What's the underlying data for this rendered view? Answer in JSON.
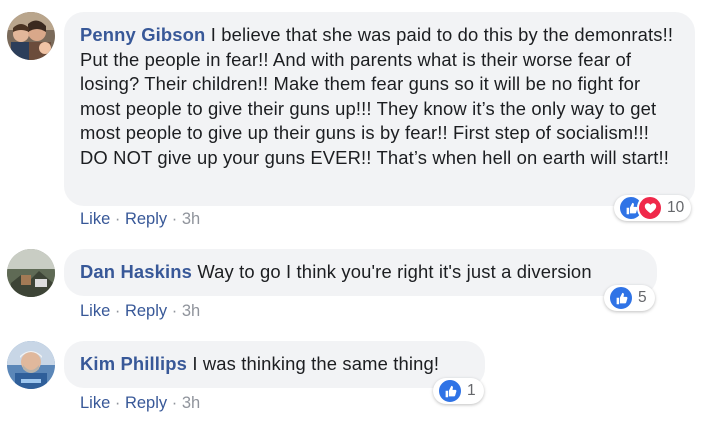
{
  "comments": [
    {
      "author": "Penny Gibson",
      "text": "I believe that she was paid to do this by the demonrats!! Put the people in fear!! And with parents what is their worse fear of losing? Their children!! Make them fear guns so it will be no fight for most people to give their guns up!!! They know it’s the only way to get most people to give up their guns is by fear!! First step of socialism!!! DO NOT give up your guns EVER!! That’s when hell on earth will start!!",
      "like_label": "Like",
      "reply_label": "Reply",
      "time": "3h",
      "reaction_count": "10",
      "reaction_types": [
        "like-icon",
        "love-icon"
      ]
    },
    {
      "author": "Dan Haskins",
      "text": "Way to go I think you're right it's just a diversion",
      "like_label": "Like",
      "reply_label": "Reply",
      "time": "3h",
      "reaction_count": "5",
      "reaction_types": [
        "like-icon"
      ]
    },
    {
      "author": "Kim Phillips",
      "text": "I was thinking the same thing!",
      "like_label": "Like",
      "reply_label": "Reply",
      "time": "3h",
      "reaction_count": "1",
      "reaction_types": [
        "like-icon"
      ]
    }
  ],
  "separator": "·",
  "colors": {
    "author_link": "#385898",
    "bubble_bg": "#f2f3f5",
    "meta_gray": "#90949c",
    "like_blue": "#2f73e6",
    "love_red": "#f0284a"
  }
}
